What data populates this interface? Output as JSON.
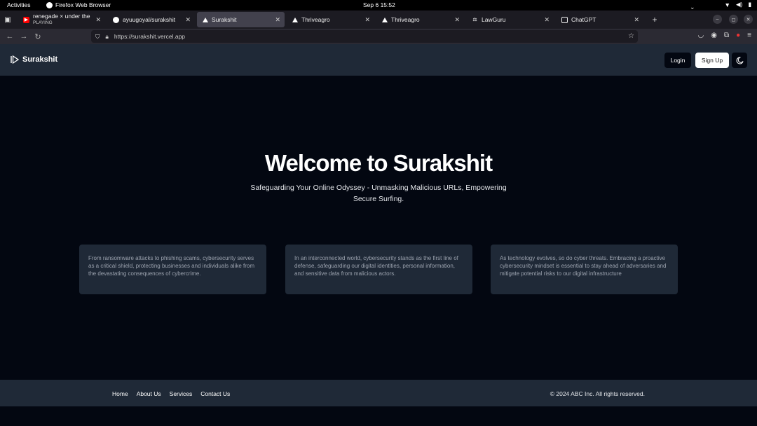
{
  "system": {
    "activities": "Activities",
    "app_name": "Firefox Web Browser",
    "clock": "Sep 6  15:52"
  },
  "tabs": [
    {
      "title": "renegade × under the infl",
      "subtitle": "PLAYING",
      "icon": "youtube-icon",
      "active": false
    },
    {
      "title": "ayuugoyal/surakshit",
      "icon": "github-icon",
      "active": false
    },
    {
      "title": "Surakshit",
      "icon": "vercel-icon",
      "active": true
    },
    {
      "title": "Thriveagro",
      "icon": "vercel-icon",
      "active": false
    },
    {
      "title": "Thriveagro",
      "icon": "vercel-icon",
      "active": false
    },
    {
      "title": "LawGuru",
      "icon": "lawguru-icon",
      "active": false
    },
    {
      "title": "ChatGPT",
      "icon": "chatgpt-icon",
      "active": false
    }
  ],
  "address_bar": {
    "url": "https://surakshit.vercel.app"
  },
  "site": {
    "brand": "Surakshit",
    "login_label": "Login",
    "signup_label": "Sign Up"
  },
  "hero": {
    "title": "Welcome to Surakshit",
    "subtitle": "Safeguarding Your Online Odyssey - Unmasking Malicious URLs, Empowering Secure Surfing."
  },
  "cards": [
    {
      "text": "From ransomware attacks to phishing scams, cybersecurity serves as a critical shield, protecting businesses and individuals alike from the devastating consequences of cybercrime."
    },
    {
      "text": "In an interconnected world, cybersecurity stands as the first line of defense, safeguarding our digital identities, personal information, and sensitive data from malicious actors."
    },
    {
      "text": "As technology evolves, so do cyber threats. Embracing a proactive cybersecurity mindset is essential to stay ahead of adversaries and mitigate potential risks to our digital infrastructure"
    }
  ],
  "footer": {
    "links": [
      "Home",
      "About Us",
      "Services",
      "Contact Us"
    ],
    "copyright": "© 2024 ABC Inc. All rights reserved."
  }
}
